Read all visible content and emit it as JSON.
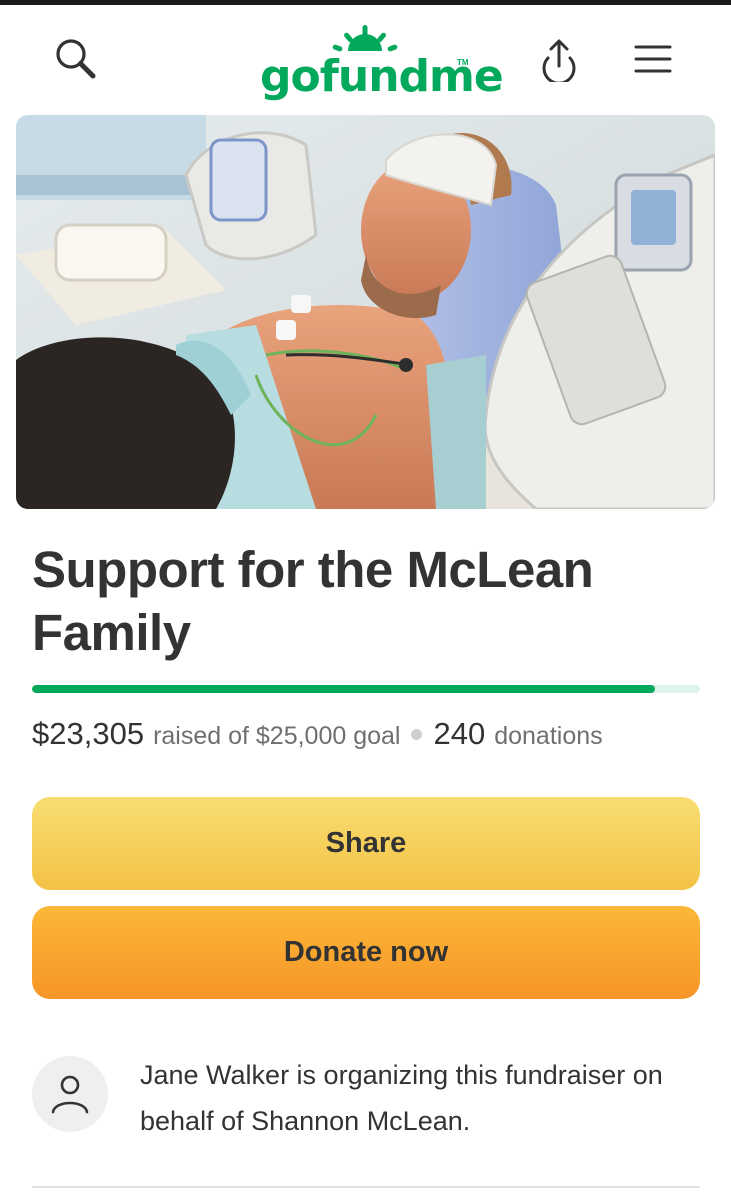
{
  "header": {
    "logo_text": "gofundme",
    "logo_tm": "TM",
    "search_icon": "search-icon",
    "share_icon": "upload-share-icon",
    "menu_icon": "hamburger-menu-icon"
  },
  "hero": {
    "image_subject": "photo"
  },
  "campaign": {
    "title": "Support for the McLean Family",
    "raised_amount": "$23,305",
    "raised_of_text": "raised of $25,000 goal",
    "donation_count": "240",
    "donations_label": "donations",
    "progress_fraction": 0.932
  },
  "actions": {
    "share_label": "Share",
    "donate_label": "Donate now"
  },
  "organizer": {
    "text": "Jane Walker is organizing this fundraiser on behalf of Shannon McLean.",
    "avatar_icon": "person-icon"
  },
  "colors": {
    "brand_green": "#02a95c",
    "share_yellow": "#f5cf5a",
    "donate_orange": "#f9a630",
    "progress_track": "#dff3ea"
  }
}
